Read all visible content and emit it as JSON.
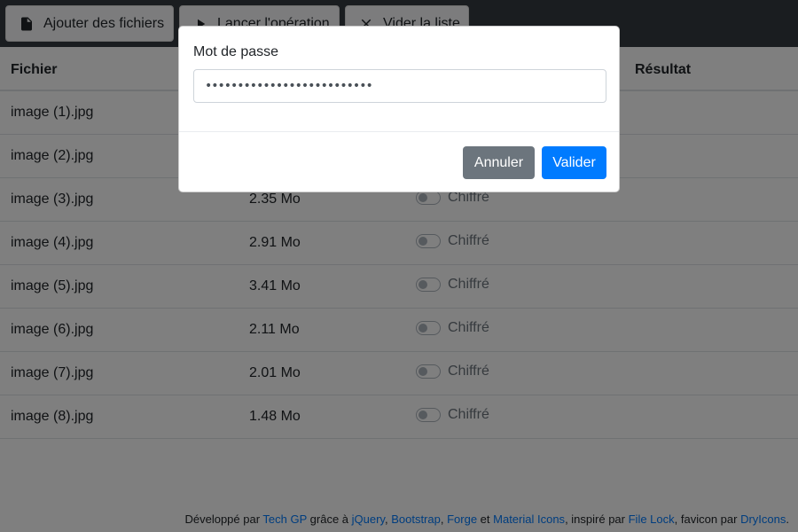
{
  "toolbar": {
    "add_label": "Ajouter des fichiers",
    "run_label": "Lancer l'opération",
    "clear_label": "Vider la liste"
  },
  "table": {
    "headers": {
      "file": "Fichier",
      "result": "Résultat"
    },
    "rows": [
      {
        "name": "image (1).jpg",
        "size": "",
        "encrypted_label": ""
      },
      {
        "name": "image (2).jpg",
        "size": "",
        "encrypted_label": ""
      },
      {
        "name": "image (3).jpg",
        "size": "2.35 Mo",
        "encrypted_label": "Chiffré"
      },
      {
        "name": "image (4).jpg",
        "size": "2.91 Mo",
        "encrypted_label": "Chiffré"
      },
      {
        "name": "image (5).jpg",
        "size": "3.41 Mo",
        "encrypted_label": "Chiffré"
      },
      {
        "name": "image (6).jpg",
        "size": "2.11 Mo",
        "encrypted_label": "Chiffré"
      },
      {
        "name": "image (7).jpg",
        "size": "2.01 Mo",
        "encrypted_label": "Chiffré"
      },
      {
        "name": "image (8).jpg",
        "size": "1.48 Mo",
        "encrypted_label": "Chiffré"
      }
    ]
  },
  "footer": {
    "t1": "Développé par ",
    "l1": "Tech GP",
    "t2": " grâce à ",
    "l2": "jQuery",
    "t3": ", ",
    "l3": "Bootstrap",
    "t4": ", ",
    "l4": "Forge",
    "t5": " et ",
    "l5": "Material Icons",
    "t6": ", inspiré par ",
    "l6": "File Lock",
    "t7": ", favicon par ",
    "l7": "DryIcons",
    "t8": "."
  },
  "modal": {
    "label": "Mot de passe",
    "password_value": "••••••••••••••••••••••••••",
    "cancel_label": "Annuler",
    "ok_label": "Valider"
  },
  "colors": {
    "toolbar_bg": "#343a40",
    "primary": "#007bff",
    "secondary": "#6c757d"
  }
}
